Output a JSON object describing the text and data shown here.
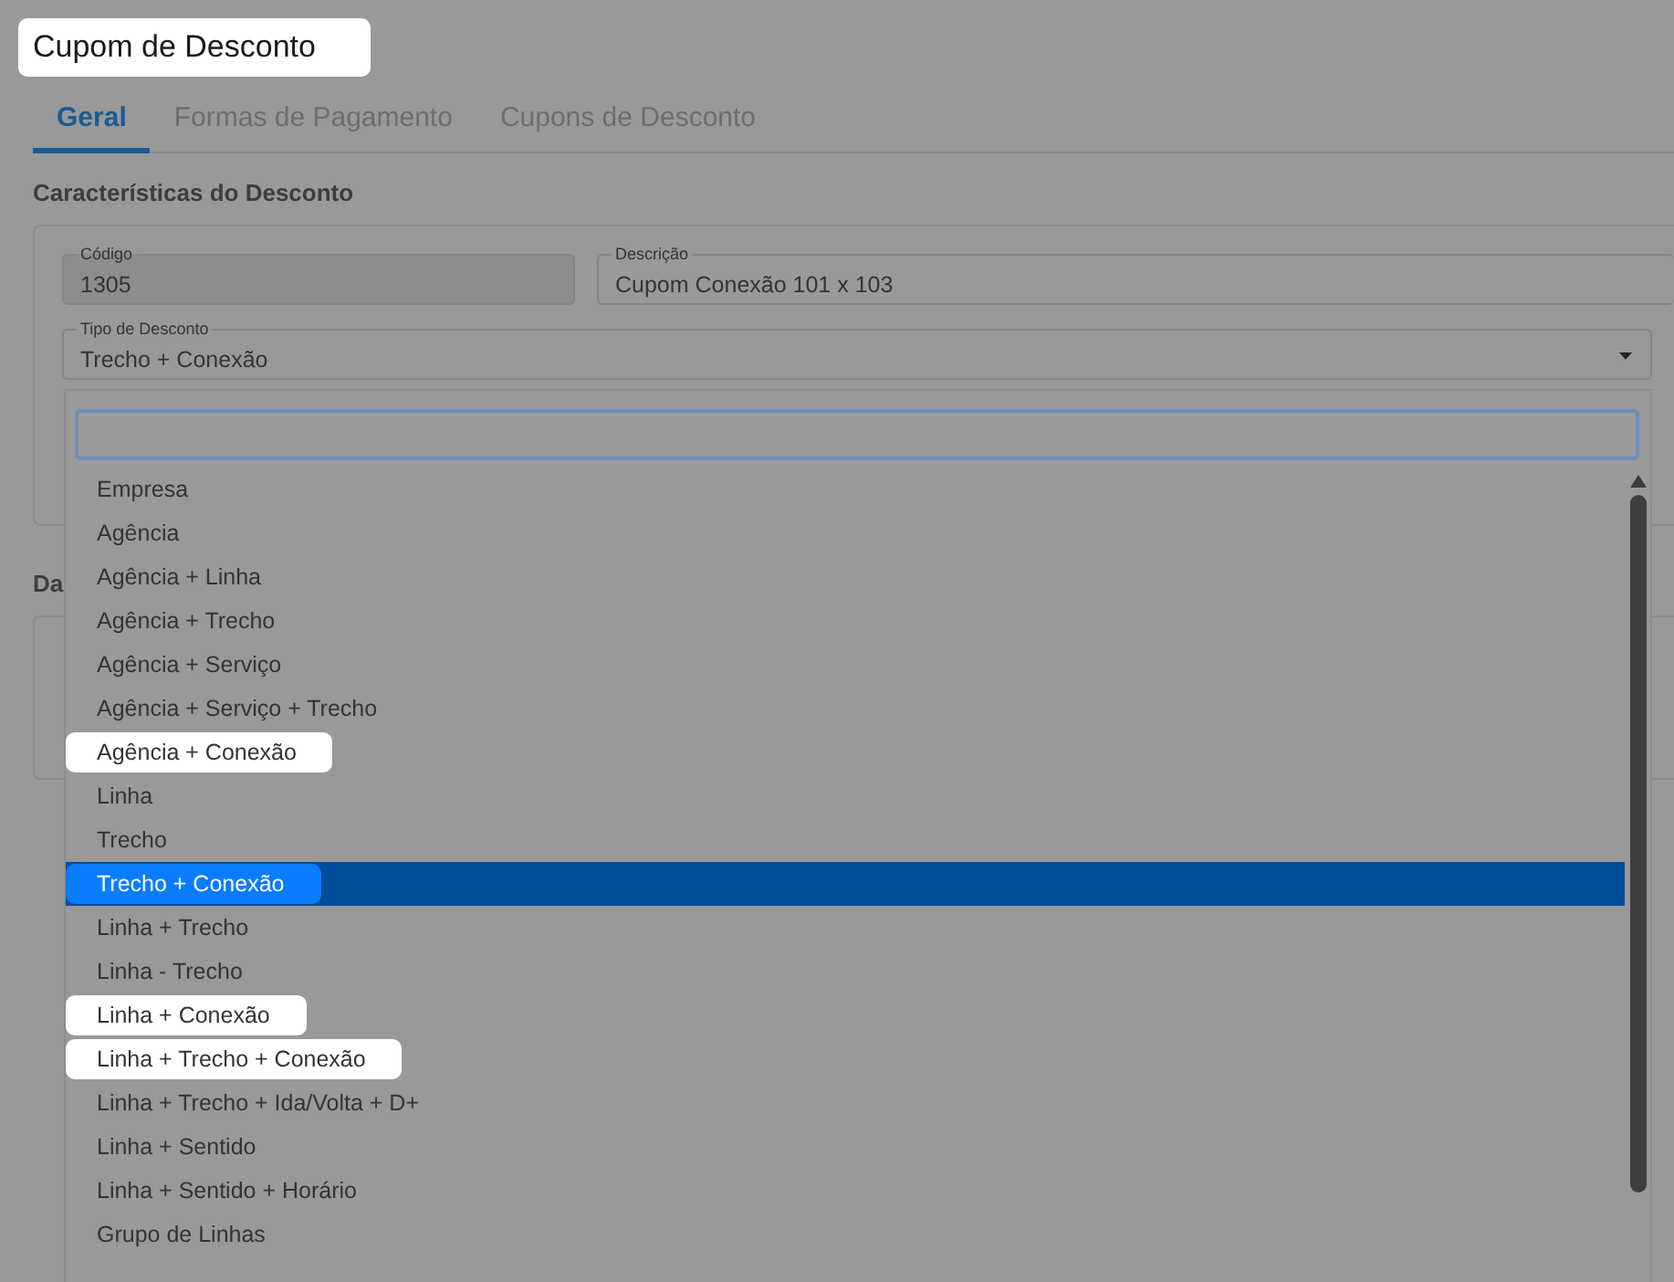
{
  "title": {
    "text": "Cupom de Desconto",
    "highlighted": true
  },
  "tabs": [
    {
      "label": "Geral",
      "selected": true
    },
    {
      "label": "Formas de Pagamento",
      "selected": false
    },
    {
      "label": "Cupons de Desconto",
      "selected": false
    }
  ],
  "section": {
    "title": "Características do Desconto",
    "fields": [
      {
        "label": "Código",
        "value": "1305",
        "disabled": true
      },
      {
        "label": "Descrição",
        "value": "Cupom Conexão 101 x 103",
        "disabled": false
      }
    ],
    "select": {
      "label": "Tipo de Desconto",
      "value": "Trecho + Conexão"
    }
  },
  "section_2": {
    "title": "Da"
  },
  "dropdown": {
    "options": [
      {
        "label": "Empresa",
        "selected": false,
        "highlighted": false
      },
      {
        "label": "Agência",
        "selected": false,
        "highlighted": false
      },
      {
        "label": "Agência + Linha",
        "selected": false,
        "highlighted": false
      },
      {
        "label": "Agência + Trecho",
        "selected": false,
        "highlighted": false
      },
      {
        "label": "Agência + Serviço",
        "selected": false,
        "highlighted": false
      },
      {
        "label": "Agência + Serviço + Trecho",
        "selected": false,
        "highlighted": false
      },
      {
        "label": "Agência + Conexão",
        "selected": false,
        "highlighted": true
      },
      {
        "label": "Linha",
        "selected": false,
        "highlighted": false
      },
      {
        "label": "Trecho",
        "selected": false,
        "highlighted": false
      },
      {
        "label": "Trecho + Conexão",
        "selected": true,
        "highlighted": true
      },
      {
        "label": "Linha + Trecho",
        "selected": false,
        "highlighted": false
      },
      {
        "label": "Linha - Trecho",
        "selected": false,
        "highlighted": false
      },
      {
        "label": "Linha + Conexão",
        "selected": false,
        "highlighted": true
      },
      {
        "label": "Linha + Trecho + Conexão",
        "selected": false,
        "highlighted": true
      },
      {
        "label": "Linha + Trecho + Ida/Volta + D+",
        "selected": false,
        "highlighted": false
      },
      {
        "label": "Linha + Sentido",
        "selected": false,
        "highlighted": false
      },
      {
        "label": "Linha + Sentido + Horário",
        "selected": false,
        "highlighted": false
      },
      {
        "label": "Grupo de Linhas",
        "selected": false,
        "highlighted": false
      }
    ]
  }
}
